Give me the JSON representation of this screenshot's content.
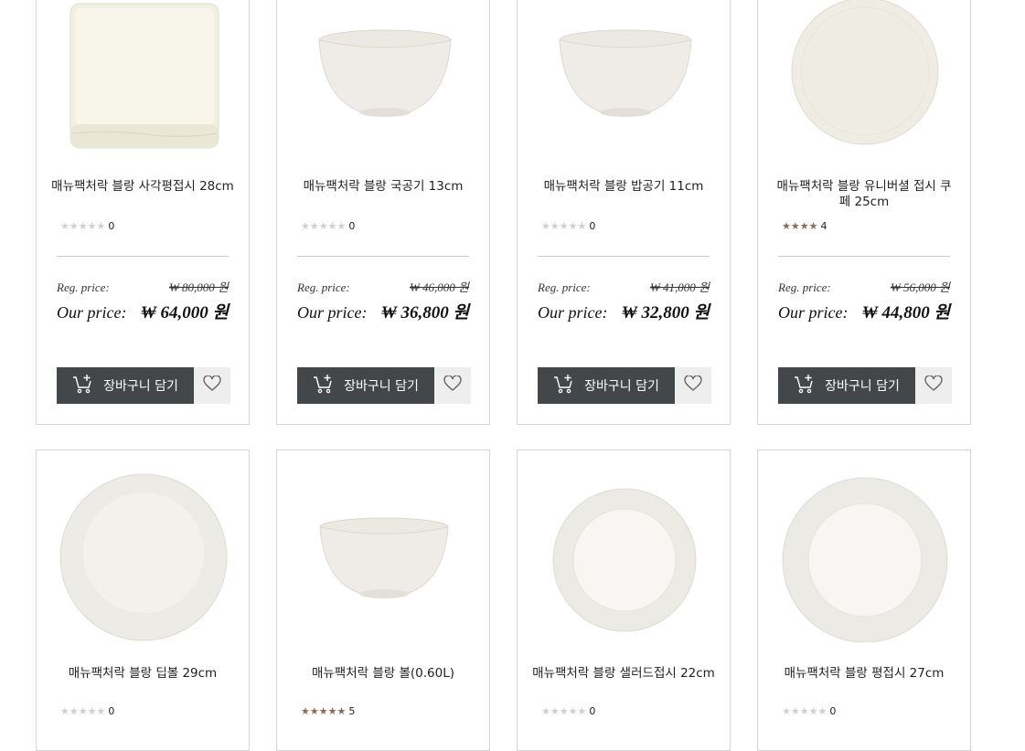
{
  "currency_symbol": "₩",
  "cart_label": "장바구니 담기",
  "reg_label": "Reg. price:",
  "our_label": "Our price:",
  "products": [
    {
      "name": "매뉴팩처락 블랑 사각평접시 28cm",
      "rating": 0,
      "stars_filled": 0,
      "reg_price": "₩ 80,000 원",
      "our_price": "₩ 64,000 원",
      "image": "square-plate"
    },
    {
      "name": "매뉴팩처락 블랑 국공기 13cm",
      "rating": 0,
      "stars_filled": 0,
      "reg_price": "₩ 46,000 원",
      "our_price": "₩ 36,800 원",
      "image": "bowl"
    },
    {
      "name": "매뉴팩처락 블랑 밥공기 11cm",
      "rating": 0,
      "stars_filled": 0,
      "reg_price": "₩ 41,000 원",
      "our_price": "₩ 32,800 원",
      "image": "bowl"
    },
    {
      "name": "매뉴팩처락 블랑 유니버셜 접시 쿠페 25cm",
      "rating": 4,
      "stars_filled": 4,
      "reg_price": "₩ 56,000 원",
      "our_price": "₩ 44,800 원",
      "image": "coupe-plate"
    },
    {
      "name": "매뉴팩처락 블랑 딥볼 29cm",
      "rating": 0,
      "stars_filled": 0,
      "image": "deep-plate"
    },
    {
      "name": "매뉴팩처락 블랑 볼(0.60L)",
      "rating": 5,
      "stars_filled": 5,
      "image": "bowl"
    },
    {
      "name": "매뉴팩처락 블랑 샐러드접시 22cm",
      "rating": 0,
      "stars_filled": 0,
      "image": "rim-plate"
    },
    {
      "name": "매뉴팩처락 블랑 평접시 27cm",
      "rating": 0,
      "stars_filled": 0,
      "image": "rim-plate"
    }
  ],
  "colors": {
    "button_dark": "#444749",
    "star_on": "#8a6a55",
    "star_off": "#cfcfcf",
    "border": "#d4d4d4"
  }
}
